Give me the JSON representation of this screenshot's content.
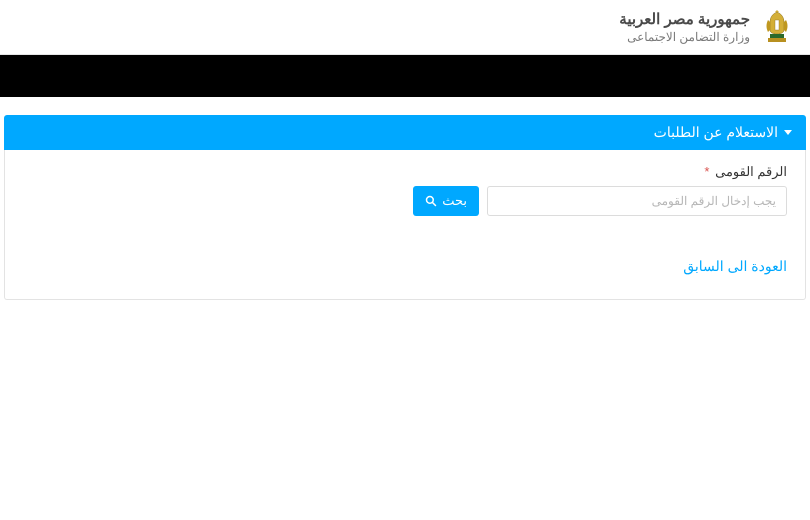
{
  "header": {
    "title": "جمهورية مصر العربية",
    "subtitle": "وزارة التضامن الاجتماعى"
  },
  "panel": {
    "title": "الاستعلام عن الطلبات"
  },
  "form": {
    "national_id_label": "الرقم القومى",
    "national_id_placeholder": "يجب إدخال الرقم القومى",
    "search_label": "بحث"
  },
  "links": {
    "back": "العودة الى السابق"
  }
}
